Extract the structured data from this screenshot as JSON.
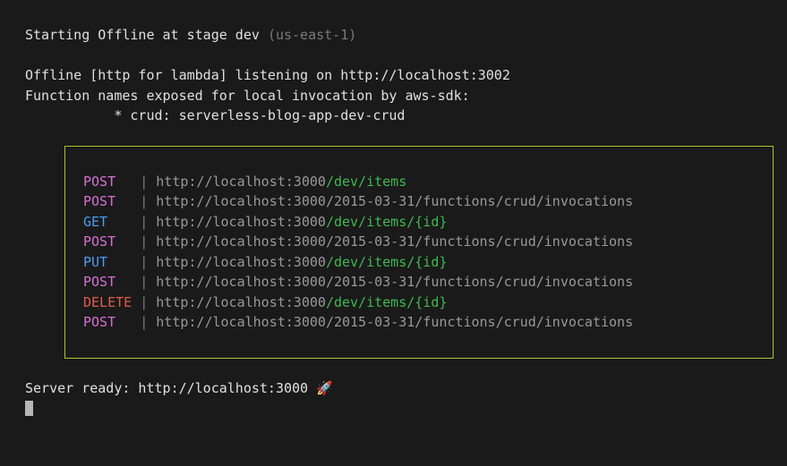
{
  "header": {
    "starting_prefix": "Starting Offline at stage dev ",
    "region": "(us-east-1)",
    "listening": "Offline [http for lambda] listening on http://localhost:3002",
    "function_names": "Function names exposed for local invocation by aws-sdk:",
    "crud_line": "           * crud: serverless-blog-app-dev-crud"
  },
  "routes": [
    {
      "method": "POST",
      "pad": "   ",
      "base": "http://localhost:3000",
      "path": "/dev/items",
      "colored": true
    },
    {
      "method": "POST",
      "pad": "   ",
      "base": "http://localhost:3000",
      "path": "/2015-03-31/functions/crud/invocations",
      "colored": false
    },
    {
      "method": "GET",
      "pad": "    ",
      "base": "http://localhost:3000",
      "path": "/dev/items/{id}",
      "colored": true
    },
    {
      "method": "POST",
      "pad": "   ",
      "base": "http://localhost:3000",
      "path": "/2015-03-31/functions/crud/invocations",
      "colored": false
    },
    {
      "method": "PUT",
      "pad": "    ",
      "base": "http://localhost:3000",
      "path": "/dev/items/{id}",
      "colored": true
    },
    {
      "method": "POST",
      "pad": "   ",
      "base": "http://localhost:3000",
      "path": "/2015-03-31/functions/crud/invocations",
      "colored": false
    },
    {
      "method": "DELETE",
      "pad": " ",
      "base": "http://localhost:3000",
      "path": "/dev/items/{id}",
      "colored": true
    },
    {
      "method": "POST",
      "pad": "   ",
      "base": "http://localhost:3000",
      "path": "/2015-03-31/functions/crud/invocations",
      "colored": false
    }
  ],
  "footer": {
    "server_ready": "Server ready: http://localhost:3000 ",
    "rocket": "🚀"
  },
  "colors": {
    "POST": "method-post",
    "GET": "method-get",
    "PUT": "method-put",
    "DELETE": "method-delete"
  }
}
